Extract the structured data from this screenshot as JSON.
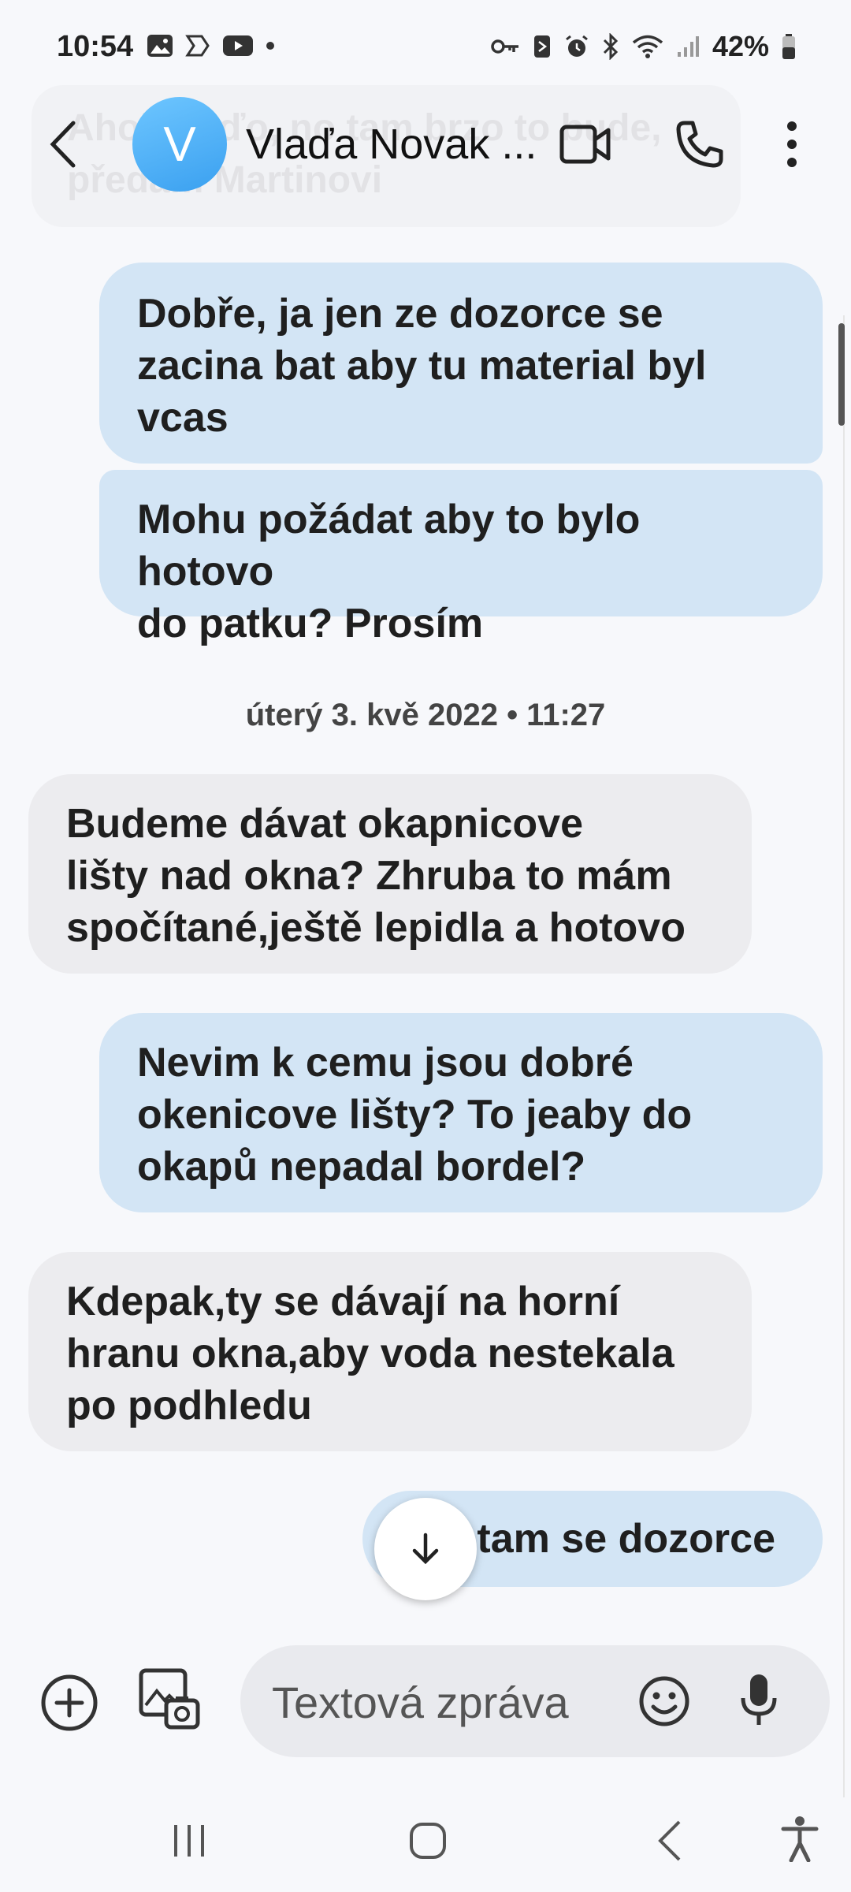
{
  "status_bar": {
    "time": "10:54",
    "battery": "42%"
  },
  "header": {
    "avatar_letter": "V",
    "contact_name": "Vlaďa Novak ...",
    "ghost_text": "Ahoj Vláďo, no tam brzo to bude, předám Martinovi"
  },
  "messages": [
    {
      "direction": "out",
      "lines": [
        "Dobře,  ja jen ze dozorce se",
        "zacina bat aby tu material byl",
        "vcas"
      ]
    },
    {
      "direction": "out",
      "lines": [
        "Mohu požádat aby to bylo hotovo",
        "do patku? Prosím"
      ]
    },
    {
      "direction": "in",
      "lines": [
        "Budeme dávat okapnicove",
        "lišty nad okna? Zhruba to mám",
        "spočítané,ještě lepidla a hotovo"
      ]
    },
    {
      "direction": "out",
      "lines": [
        "Nevim k cemu jsou dobré",
        "okenicove lišty? To jeaby do",
        "okapů nepadal bordel?"
      ]
    },
    {
      "direction": "in",
      "lines": [
        "Kdepak,ty se dávají na horní",
        "hranu okna,aby voda nestekala",
        "po podhledu"
      ]
    },
    {
      "direction": "out",
      "lines": [
        "tam se dozorce"
      ]
    }
  ],
  "date_separator": "úterý 3. kvě 2022 • 11:27",
  "composer": {
    "placeholder": "Textová zpráva"
  },
  "colors": {
    "outgoing_bubble": "#d3e5f5",
    "incoming_bubble": "#ececef",
    "avatar": "#4ab0f5"
  },
  "icons": [
    "back-icon",
    "video-call-icon",
    "phone-icon",
    "more-icon",
    "add-icon",
    "gallery-icon",
    "emoji-icon",
    "mic-icon",
    "arrow-down-icon",
    "recents-icon",
    "home-icon",
    "nav-back-icon",
    "accessibility-icon"
  ]
}
